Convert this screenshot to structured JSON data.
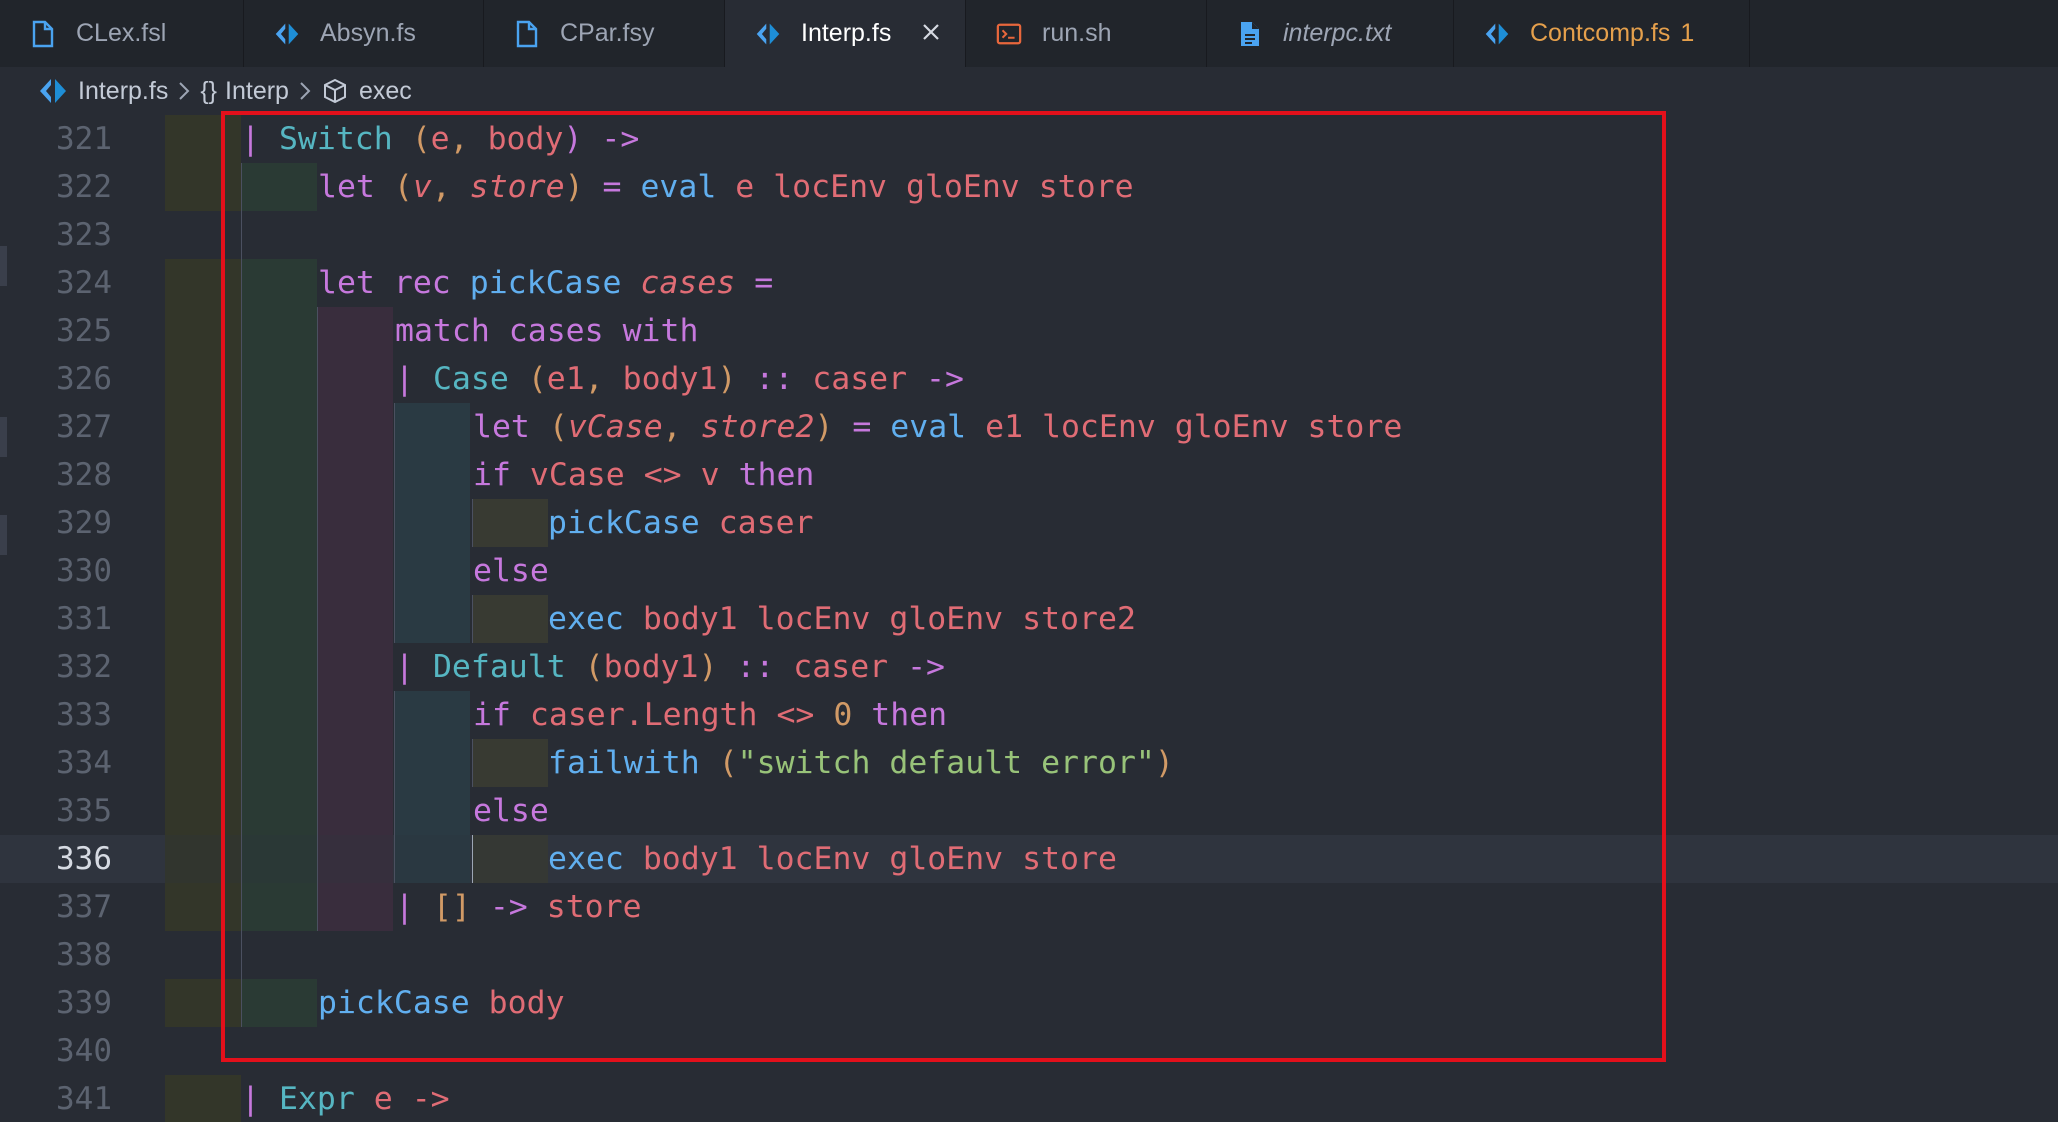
{
  "tabs": [
    {
      "label": "CLex.fsl",
      "icon": "file-icon"
    },
    {
      "label": "Absyn.fs",
      "icon": "fsharp-icon"
    },
    {
      "label": "CPar.fsy",
      "icon": "file-icon"
    },
    {
      "label": "Interp.fs",
      "icon": "fsharp-icon",
      "active": true
    },
    {
      "label": "run.sh",
      "icon": "terminal-icon"
    },
    {
      "label": "interpc.txt",
      "icon": "text-file-icon"
    },
    {
      "label": "Contcomp.fs",
      "icon": "fsharp-icon",
      "badge": "1"
    }
  ],
  "breadcrumb": {
    "file": "Interp.fs",
    "module": "Interp",
    "module_prefix": "{}",
    "symbol": "exec"
  },
  "editor": {
    "current_line": "336",
    "lines": [
      {
        "num": "321"
      },
      {
        "num": "322"
      },
      {
        "num": "323"
      },
      {
        "num": "324"
      },
      {
        "num": "325"
      },
      {
        "num": "326"
      },
      {
        "num": "327"
      },
      {
        "num": "328"
      },
      {
        "num": "329"
      },
      {
        "num": "330"
      },
      {
        "num": "331"
      },
      {
        "num": "332"
      },
      {
        "num": "333"
      },
      {
        "num": "334"
      },
      {
        "num": "335"
      },
      {
        "num": "336"
      },
      {
        "num": "337"
      },
      {
        "num": "338"
      },
      {
        "num": "339"
      },
      {
        "num": "340"
      },
      {
        "num": "341"
      }
    ],
    "tokens": {
      "l321": [
        "| ",
        "Switch",
        " (",
        "e",
        ", ",
        "body",
        ") ->"
      ],
      "l322": [
        "let",
        " (",
        "v",
        ", ",
        "store",
        ")",
        " = ",
        "eval",
        " e locEnv gloEnv store"
      ],
      "l324": [
        "let rec",
        " ",
        "pickCase",
        " ",
        "cases",
        " ="
      ],
      "l325": [
        "match cases with"
      ],
      "l326": [
        "| ",
        "Case",
        " (",
        "e1",
        ", ",
        "body1",
        ")",
        " :: ",
        "caser",
        " ->"
      ],
      "l327": [
        "let",
        " (",
        "vCase",
        ", ",
        "store2",
        ")",
        " = ",
        "eval",
        " e1 locEnv gloEnv store"
      ],
      "l328": [
        "if",
        " vCase <> v ",
        "then"
      ],
      "l329": [
        "pickCase",
        " caser"
      ],
      "l330": [
        "else"
      ],
      "l331": [
        "exec",
        " body1 locEnv gloEnv store2"
      ],
      "l332": [
        "| ",
        "Default",
        " (",
        "body1",
        ")",
        " :: ",
        "caser",
        " ->"
      ],
      "l333": [
        "if",
        " caser.Length <> ",
        "0",
        " ",
        "then"
      ],
      "l334": [
        "failwith",
        " (",
        "\"switch default error\"",
        ")"
      ],
      "l335": [
        "else"
      ],
      "l336": [
        "exec",
        " body1 locEnv gloEnv store"
      ],
      "l337": [
        "| ",
        "[]",
        " -> ",
        "store"
      ],
      "l339": [
        "pickCase",
        " body"
      ],
      "l341": [
        "| ",
        "Expr",
        " e ->"
      ]
    }
  }
}
